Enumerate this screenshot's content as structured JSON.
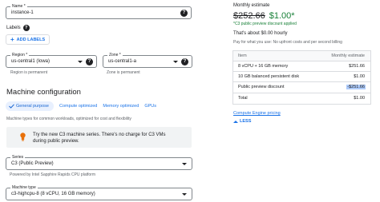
{
  "name_field": {
    "label": "Name *",
    "value": "instance-1"
  },
  "labels": {
    "title": "Labels",
    "add_button": "ADD LABELS"
  },
  "region_field": {
    "label": "Region *",
    "value": "us-central1 (Iowa)",
    "hint": "Region is permanent"
  },
  "zone_field": {
    "label": "Zone *",
    "value": "us-central1-a",
    "hint": "Zone is permanent"
  },
  "machine_config": {
    "title": "Machine configuration",
    "tabs": [
      "General purpose",
      "Compute optimized",
      "Memory optimized",
      "GPUs"
    ],
    "description": "Machine types for common workloads, optimized for cost and flexibility"
  },
  "c3_banner": {
    "text": "Try the new C3 machine series. There's no charge for C3 VMs during public preview."
  },
  "series_field": {
    "label": "Series",
    "value": "C3 (Public Preview)",
    "hint": "Powered by Intel Sapphire Rapids CPU platform"
  },
  "machine_type_field": {
    "label": "Machine type",
    "value": "c3-highcpu-8 (8 vCPU, 16 GB memory)"
  },
  "estimate": {
    "title": "Monthly estimate",
    "old_price": "$252.66",
    "new_price": "$1.00*",
    "discount_note": "*C3 public preview discount applied",
    "hourly": "That's about $0.00 hourly",
    "pay_note": "Pay for what you use: No upfront costs and per second billing",
    "table": {
      "headers": [
        "Item",
        "Monthly estimate"
      ],
      "rows": [
        [
          "8 vCPU + 16 GB memory",
          "$251.66"
        ],
        [
          "10 GB balanced persistent disk",
          "$1.00"
        ],
        [
          "Public preview discount",
          "-$251.66"
        ],
        [
          "Total",
          "$1.00"
        ]
      ]
    },
    "pricing_link": "Compute Engine pricing",
    "less_label": "LESS"
  },
  "colors": {
    "accent": "#1a73e8",
    "green": "#188038",
    "orange": "#e8710a",
    "highlight": "#aecbfa"
  }
}
